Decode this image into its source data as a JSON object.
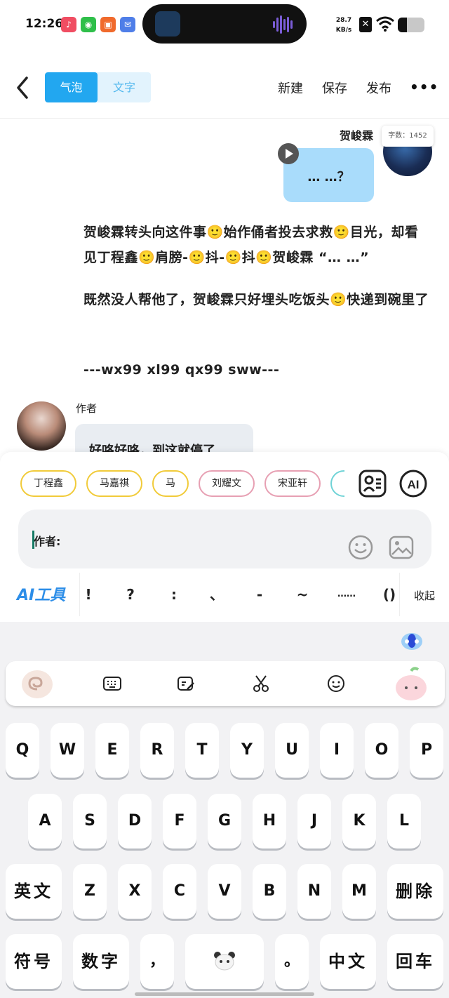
{
  "status_bar": {
    "time": "12:26",
    "net_speed_value": "28.7",
    "net_speed_unit": "KB/s",
    "battery_level": 0.33
  },
  "nav": {
    "tab_bubble": "气泡",
    "tab_text": "文字",
    "new_label": "新建",
    "save_label": "保存",
    "publish_label": "发布",
    "more_label": "•••"
  },
  "chat": {
    "speaker_name": "贺峻霖",
    "word_count": "字数：1452",
    "bubble_text": "… …？",
    "paragraphs": [
      "贺峻霖转头向这件事🙂始作俑者投去求救🙂目光，却看见丁程鑫🙂肩膀-🙂抖-🙂抖🙂贺峻霖 “… …”",
      "既然没人帮他了，贺峻霖只好埋头吃饭头🙂快递到碗里了",
      "---wx99  xl99  qx99  sww---"
    ],
    "author_label": "作者",
    "author_bubble": "好咯好咯，到这就停了"
  },
  "panel": {
    "chips": [
      "丁程鑫",
      "马嘉祺",
      "马",
      "刘耀文",
      "宋亚轩"
    ],
    "input_value": "作者:",
    "ai_tools_label": "AI工具",
    "punctuation": [
      "!",
      "?",
      ":",
      "、",
      "-",
      "~",
      "……",
      "()"
    ],
    "collapse_label": "收起"
  },
  "keyboard": {
    "row1": [
      "Q",
      "W",
      "E",
      "R",
      "T",
      "Y",
      "U",
      "I",
      "O",
      "P"
    ],
    "row2": [
      "A",
      "S",
      "D",
      "F",
      "G",
      "H",
      "J",
      "K",
      "L"
    ],
    "row3": [
      "Z",
      "X",
      "C",
      "V",
      "B",
      "N",
      "M"
    ],
    "english_key": "英文",
    "delete_key": "删除",
    "symbol_key": "符号",
    "number_key": "数字",
    "comma_key": "，",
    "period_key": "。",
    "chinese_key": "中文",
    "enter_key": "回车"
  }
}
